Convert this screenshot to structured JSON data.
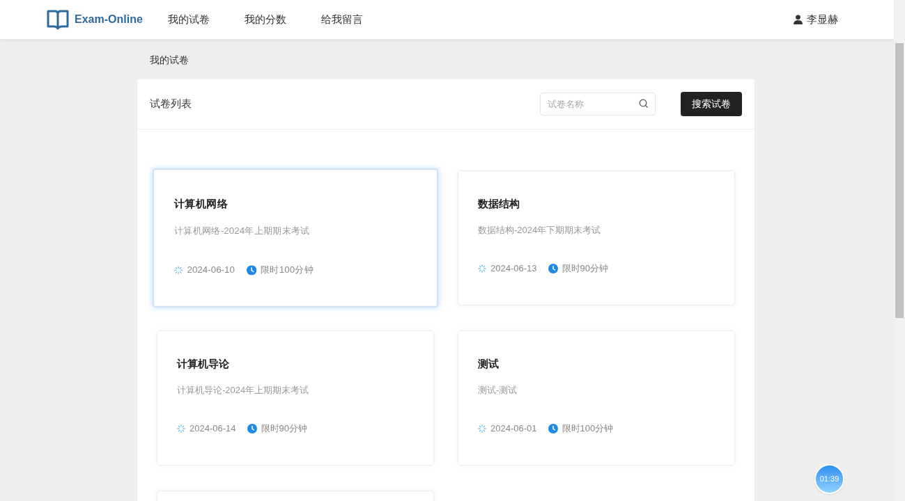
{
  "brand": {
    "name": "Exam-Online"
  },
  "nav": [
    {
      "label": "我的试卷",
      "selected": false
    },
    {
      "label": "我的分数",
      "selected": false
    },
    {
      "label": "给我留言",
      "selected": false
    }
  ],
  "user": {
    "name": "李显赫"
  },
  "breadcrumb": "我的试卷",
  "panel": {
    "title": "试卷列表",
    "search": {
      "placeholder": "试卷名称"
    },
    "button": "搜索试卷"
  },
  "papers": [
    {
      "title": "计算机网络",
      "description": "计算机网络-2024年上期期末考试",
      "date": "2024-06-10",
      "limit": "限时100分钟",
      "hovered": true
    },
    {
      "title": "数据结构",
      "description": "数据结构-2024年下期期末考试",
      "date": "2024-06-13",
      "limit": "限时90分钟",
      "hovered": false
    },
    {
      "title": "计算机导论",
      "description": "计算机导论-2024年上期期末考试",
      "date": "2024-06-14",
      "limit": "限时90分钟",
      "hovered": false
    },
    {
      "title": "测试",
      "description": "测试-测试",
      "date": "2024-06-01",
      "limit": "限时100分钟",
      "hovered": false
    }
  ],
  "timer": "01:39"
}
